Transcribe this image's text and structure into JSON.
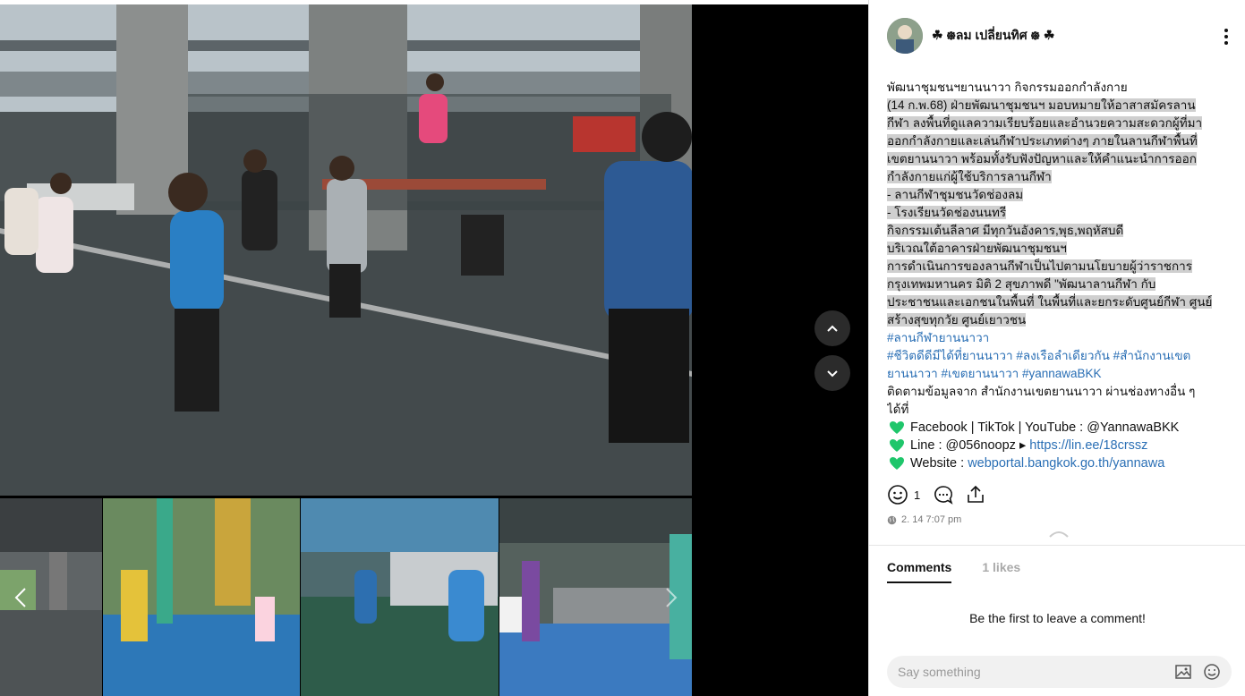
{
  "author": {
    "name": "☘ ᪥ลม เปลี่ยนทิศ ᪥ ☘"
  },
  "post": {
    "lines": [
      {
        "text": "พัฒนาชุมชนฯยานนาวา กิจกรรมออกกำลังกาย",
        "highlight": false
      },
      {
        "text": " (14 ก.พ.68)  ฝ่ายพัฒนาชุมชนฯ มอบหมายให้อาสาสมัครลาน",
        "highlight": true
      },
      {
        "text": "กีฬา ลงพื้นที่ดูแลความเรียบร้อยและอำนวยความสะดวกผู้ที่มา",
        "highlight": true
      },
      {
        "text": "ออกกำลังกายและเล่นกีฬาประเภทต่างๆ ภายในลานกีฬาพื้นที่",
        "highlight": true
      },
      {
        "text": "เขตยานนาวา พร้อมทั้งรับฟังปัญหาและให้คำแนะนำการออก",
        "highlight": true
      },
      {
        "text": "กำลังกายแก่ผู้ใช้บริการลานกีฬา",
        "highlight": true
      },
      {
        "text": "- ลานกีฬาชุมชนวัดช่องลม",
        "highlight": true
      },
      {
        "text": "- โรงเรียนวัดช่องนนทรี",
        "highlight": true
      },
      {
        "text": "กิจกรรมเต้นลีลาศ มีทุกวันอังคาร,พุธ,พฤหัสบดี",
        "highlight": true
      },
      {
        "text": "บริเวณใต้อาคารฝ่ายพัฒนาชุมชนฯ",
        "highlight": true
      },
      {
        "text": "   การดำเนินการของลานกีฬาเป็นไปตามนโยบายผู้ว่าราชการ",
        "highlight": true
      },
      {
        "text": "กรุงเทพมหานคร  มิติ 2 สุขภาพดี  \"พัฒนาลานกีฬา กับ",
        "highlight": true
      },
      {
        "text": "ประชาชนและเอกชนในพื้นที่ ในพื้นที่และยกระดับศูนย์กีฬา ศูนย์",
        "highlight": true
      },
      {
        "text": "สร้างสุขทุกวัย ศูนย์เยาวชน",
        "highlight": true
      }
    ],
    "hashtags": [
      "#ลานกีฬายานนาวา",
      "#ชีวิตดีดีมีได้ที่ยานนาวา #ลงเรือลำเดียวกัน #สำนักงานเขต",
      "ยานนาวา #เขตยานนาวา #yannawaBKK"
    ],
    "follow_lines": [
      "ติดตามข้อมูลจาก สำนักงานเขตยานนาวา ผ่านช่องทางอื่น ๆ",
      "ได้ที่"
    ],
    "channels": [
      {
        "label": "Facebook | TikTok | YouTube : @YannawaBKK",
        "link": ""
      },
      {
        "label": "Line : @056noopz ▸ ",
        "link": "https://lin.ee/18crssz"
      },
      {
        "label": "Website : ",
        "link": "webportal.bangkok.go.th/yannawa"
      }
    ]
  },
  "actions": {
    "reaction_count": "1"
  },
  "meta": {
    "timestamp": "2. 14 7:07 pm"
  },
  "tabs": {
    "comments": "Comments",
    "likes": "1 likes"
  },
  "comments": {
    "empty_text": "Be the first to leave a comment!"
  },
  "composer": {
    "placeholder": "Say something"
  },
  "icons": {
    "prev_photo": "chevron-up-icon",
    "next_photo": "chevron-down-icon",
    "more": "more-vertical-icon",
    "reaction": "smiley-icon",
    "comment": "comment-icon",
    "share": "share-icon",
    "visibility": "globe-icon",
    "image": "image-icon",
    "emoji": "emoji-icon"
  },
  "colors": {
    "link": "#2a6fb5",
    "heart": "#1fc66b",
    "highlight": "#cfcfcf"
  }
}
